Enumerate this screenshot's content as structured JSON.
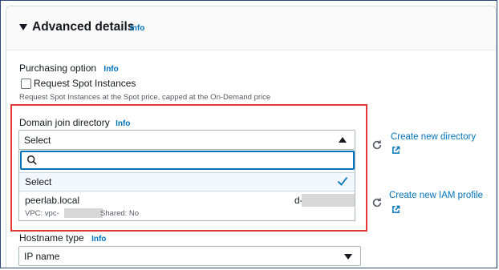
{
  "section": {
    "title": "Advanced details",
    "info": "Info"
  },
  "purchasing": {
    "label": "Purchasing option",
    "info": "Info",
    "checkbox_label": "Request Spot Instances",
    "checked": false,
    "hint": "Request Spot Instances at the Spot price, capped at the On-Demand price"
  },
  "domain": {
    "label": "Domain join directory",
    "info": "Info",
    "select_value": "Select",
    "search_placeholder": "",
    "options": [
      {
        "label": "Select",
        "selected": true
      },
      {
        "label": "peerlab.local",
        "id_prefix": "d-",
        "vpc_prefix": "VPC: vpc-",
        "shared": "Shared: No"
      }
    ]
  },
  "links": {
    "create_directory": "Create new directory",
    "create_iam_profile": "Create new IAM profile"
  },
  "hostname": {
    "label": "Hostname type",
    "info": "Info",
    "select_value": "IP name"
  },
  "colors": {
    "link": "#0073bb",
    "highlight": "#e53935",
    "focus": "#0073bb"
  },
  "icons": [
    "caret-down-icon",
    "search-icon",
    "check-icon",
    "refresh-icon",
    "external-link-icon"
  ]
}
